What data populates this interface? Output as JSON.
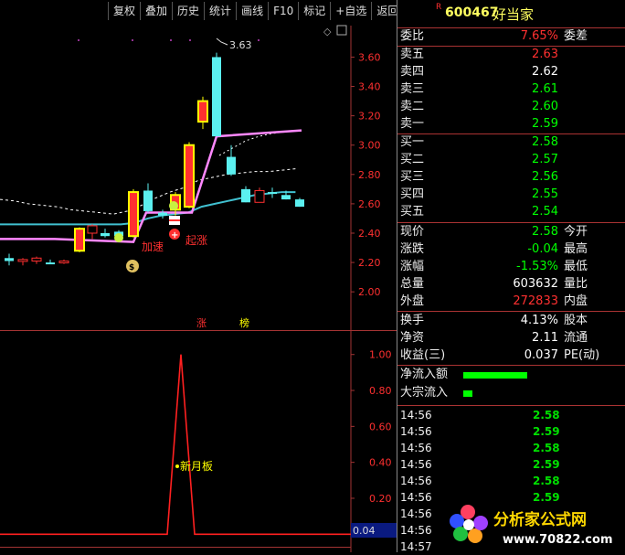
{
  "toolbar": {
    "items": [
      "复权",
      "叠加",
      "历史",
      "统计",
      "画线",
      "F10",
      "标记",
      "+自选",
      "返回"
    ]
  },
  "stock": {
    "badge": "R",
    "code": "600467",
    "name": "好当家"
  },
  "main_chart": {
    "type": "candlestick",
    "y_ticks": [
      "3.60",
      "3.40",
      "3.20",
      "3.00",
      "2.80",
      "2.60",
      "2.40",
      "2.20",
      "2.00"
    ],
    "ylim": [
      1.92,
      3.74
    ],
    "high_marker": "3.63",
    "signals": {
      "accel": "加速",
      "rise": "起涨",
      "zhang": "涨",
      "bang": "榜"
    },
    "candles": [
      {
        "o": 2.23,
        "h": 2.26,
        "l": 2.18,
        "c": 2.21,
        "color": "cyan"
      },
      {
        "o": 2.22,
        "h": 2.23,
        "l": 2.18,
        "c": 2.21,
        "color": "red"
      },
      {
        "o": 2.21,
        "h": 2.24,
        "l": 2.19,
        "c": 2.23,
        "color": "red"
      },
      {
        "o": 2.2,
        "h": 2.22,
        "l": 2.19,
        "c": 2.19,
        "color": "cyan"
      },
      {
        "o": 2.21,
        "h": 2.22,
        "l": 2.19,
        "c": 2.2,
        "color": "red"
      },
      {
        "o": 2.28,
        "h": 2.44,
        "l": 2.27,
        "c": 2.43,
        "color": "yellow"
      },
      {
        "o": 2.4,
        "h": 2.46,
        "l": 2.36,
        "c": 2.45,
        "color": "red"
      },
      {
        "o": 2.4,
        "h": 2.43,
        "l": 2.37,
        "c": 2.38,
        "color": "cyan"
      },
      {
        "o": 2.38,
        "h": 2.42,
        "l": 2.35,
        "c": 2.41,
        "color": "cyan"
      },
      {
        "o": 2.38,
        "h": 2.7,
        "l": 2.37,
        "c": 2.68,
        "color": "yellow"
      },
      {
        "o": 2.55,
        "h": 2.74,
        "l": 2.54,
        "c": 2.69,
        "color": "cyan"
      },
      {
        "o": 2.52,
        "h": 2.56,
        "l": 2.5,
        "c": 2.54,
        "color": "cyan"
      },
      {
        "o": 2.56,
        "h": 2.68,
        "l": 2.52,
        "c": 2.66,
        "color": "yellow"
      },
      {
        "o": 2.58,
        "h": 3.02,
        "l": 2.57,
        "c": 3.0,
        "color": "yellow"
      },
      {
        "o": 3.3,
        "h": 3.33,
        "l": 3.11,
        "c": 3.16,
        "color": "yellow"
      },
      {
        "o": 3.06,
        "h": 3.63,
        "l": 3.06,
        "c": 3.6,
        "color": "cyan"
      },
      {
        "o": 2.92,
        "h": 3.0,
        "l": 2.79,
        "c": 2.8,
        "color": "cyan"
      },
      {
        "o": 2.7,
        "h": 2.72,
        "l": 2.61,
        "c": 2.61,
        "color": "cyan"
      },
      {
        "o": 2.61,
        "h": 2.71,
        "l": 2.61,
        "c": 2.69,
        "color": "red"
      },
      {
        "o": 2.68,
        "h": 2.71,
        "l": 2.64,
        "c": 2.67,
        "color": "cyan"
      },
      {
        "o": 2.66,
        "h": 2.69,
        "l": 2.63,
        "c": 2.63,
        "color": "cyan"
      },
      {
        "o": 2.63,
        "h": 2.64,
        "l": 2.58,
        "c": 2.58,
        "color": "cyan"
      }
    ],
    "ma_cyan": [
      2.46,
      2.46,
      2.46,
      2.46,
      2.46,
      2.46,
      2.46,
      2.46,
      2.46,
      2.46,
      2.47,
      2.5,
      2.52,
      2.53,
      2.54,
      2.58,
      2.6,
      2.62,
      2.64,
      2.66,
      2.67,
      2.68,
      2.68
    ],
    "ma_dash": [
      2.63,
      2.62,
      2.6,
      2.59,
      2.58,
      2.56,
      2.55,
      2.54,
      2.53,
      2.55,
      2.59,
      2.64,
      2.68,
      2.71,
      2.76,
      2.78,
      2.8,
      2.81,
      2.82,
      2.82,
      2.83,
      2.84
    ],
    "ma_dash2": [
      2.93,
      2.98,
      3.03,
      3.06,
      3.08,
      3.09,
      3.1
    ]
  },
  "sub_chart": {
    "y_ticks": [
      "1.00",
      "0.80",
      "0.60",
      "0.40",
      "0.20"
    ],
    "ylim": [
      -0.08,
      1.08
    ],
    "current_value": "0.04",
    "label": "新月板",
    "values": [
      0,
      0,
      0,
      0,
      0,
      0,
      0,
      0,
      0,
      0,
      0,
      0,
      0,
      1,
      0,
      0,
      0,
      0,
      0,
      0,
      0,
      0
    ]
  },
  "colors": {
    "up": "#ff3030",
    "down": "#5bf0f0",
    "yellow": "#ffff00",
    "bg": "#000000",
    "grid": "#a33333",
    "pink": "#ff88ff"
  },
  "quote": {
    "weibi": {
      "label": "委比",
      "value": "7.65%",
      "label2": "委差"
    },
    "sell": [
      {
        "label": "卖五",
        "price": "2.63"
      },
      {
        "label": "卖四",
        "price": "2.62"
      },
      {
        "label": "卖三",
        "price": "2.61"
      },
      {
        "label": "卖二",
        "price": "2.60"
      },
      {
        "label": "卖一",
        "price": "2.59"
      }
    ],
    "buy": [
      {
        "label": "买一",
        "price": "2.58"
      },
      {
        "label": "买二",
        "price": "2.57"
      },
      {
        "label": "买三",
        "price": "2.56"
      },
      {
        "label": "买四",
        "price": "2.55"
      },
      {
        "label": "买五",
        "price": "2.54"
      }
    ],
    "stats": [
      {
        "label": "现价",
        "value": "2.58",
        "label2": "今开",
        "cls": "g"
      },
      {
        "label": "涨跌",
        "value": "-0.04",
        "label2": "最高",
        "cls": "g"
      },
      {
        "label": "涨幅",
        "value": "-1.53%",
        "label2": "最低",
        "cls": "g"
      },
      {
        "label": "总量",
        "value": "603632",
        "label2": "量比",
        "cls": "w"
      },
      {
        "label": "外盘",
        "value": "272833",
        "label2": "内盘",
        "cls": "r"
      }
    ],
    "stats2": [
      {
        "label": "换手",
        "value": "4.13%",
        "label2": "股本",
        "cls": "w"
      },
      {
        "label": "净资",
        "value": "2.11",
        "label2": "流通",
        "cls": "w"
      },
      {
        "label": "收益(三)",
        "value": "0.037",
        "label2": "PE(动)",
        "cls": "w"
      }
    ],
    "flows": [
      {
        "label": "净流入额",
        "level": 0.7
      },
      {
        "label": "大宗流入",
        "level": 0.1
      }
    ]
  },
  "ticks": [
    {
      "time": "14:56",
      "price": "2.58"
    },
    {
      "time": "14:56",
      "price": "2.59"
    },
    {
      "time": "14:56",
      "price": "2.58"
    },
    {
      "time": "14:56",
      "price": "2.59"
    },
    {
      "time": "14:56",
      "price": "2.58"
    },
    {
      "time": "14:56",
      "price": "2.59"
    },
    {
      "time": "14:56",
      "price": ""
    },
    {
      "time": "14:56",
      "price": ""
    },
    {
      "time": "14:57",
      "price": ""
    }
  ],
  "watermark": {
    "name": "分析家公式网",
    "url": "www.70822.com"
  }
}
